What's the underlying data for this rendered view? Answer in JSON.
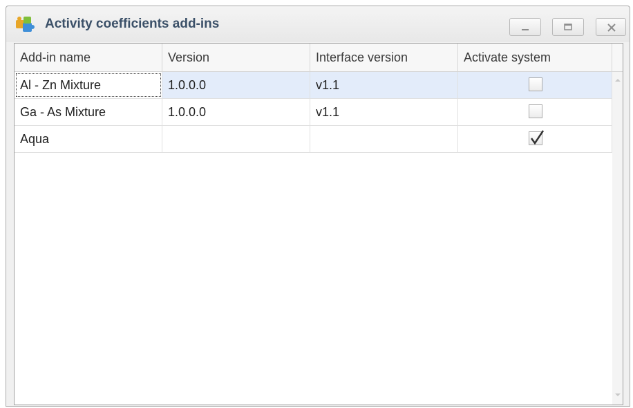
{
  "window": {
    "title": "Activity coefficients add-ins",
    "icon": "addin-puzzle-icon",
    "buttons": [
      "minimize-icon",
      "maximize-icon",
      "close-icon"
    ]
  },
  "grid": {
    "columns": [
      "Add-in name",
      "Version",
      "Interface version",
      "Activate system"
    ],
    "rows": [
      {
        "name": "Al - Zn Mixture",
        "version": "1.0.0.0",
        "interface_version": "v1.1",
        "activated": false,
        "selected": true
      },
      {
        "name": "Ga - As Mixture",
        "version": "1.0.0.0",
        "interface_version": "v1.1",
        "activated": false,
        "selected": false
      },
      {
        "name": "Aqua",
        "version": "",
        "interface_version": "",
        "activated": true,
        "selected": false
      }
    ]
  },
  "colors": {
    "title_text": "#3b5068",
    "selected_row": "#e3ecfa",
    "window_bg": "#f0f0f0"
  }
}
